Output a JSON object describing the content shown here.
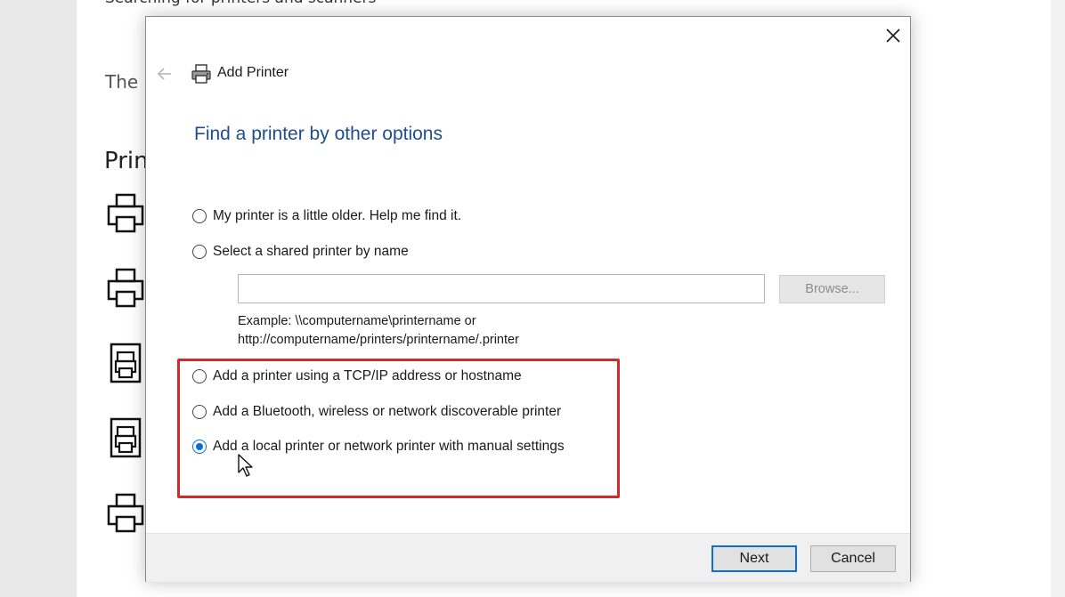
{
  "background": {
    "header_text": "Searching for printers and scanners",
    "description": "The p",
    "section_title": "Prin",
    "device_icons": [
      "printer-icon",
      "printer-icon",
      "fax-icon",
      "fax-icon",
      "printer-icon"
    ]
  },
  "dialog": {
    "title": "Add Printer",
    "heading": "Find a printer by other options",
    "options": [
      {
        "label": "My printer is a little older. Help me find it.",
        "checked": false
      },
      {
        "label": "Select a shared printer by name",
        "checked": false
      },
      {
        "label": "Add a printer using a TCP/IP address or hostname",
        "checked": false
      },
      {
        "label": "Add a Bluetooth, wireless or network discoverable printer",
        "checked": false
      },
      {
        "label": "Add a local printer or network printer with manual settings",
        "checked": true
      }
    ],
    "shared_printer_value": "",
    "browse_label": "Browse...",
    "example_line1": "Example: \\\\computername\\printername or",
    "example_line2": "http://computername/printers/printername/.printer",
    "next_label": "Next",
    "cancel_label": "Cancel"
  },
  "colors": {
    "accent": "#0b6fd6",
    "heading": "#1f4e8c",
    "highlight": "#d9262a"
  }
}
